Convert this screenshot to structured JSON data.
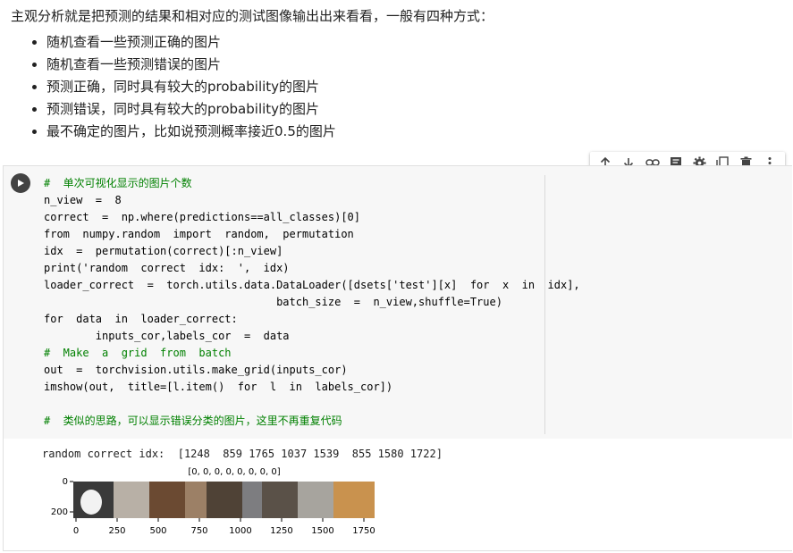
{
  "markdown": {
    "intro": "主观分析就是把预测的结果和相对应的测试图像输出出来看看，一般有四种方式：",
    "items": [
      "随机查看一些预测正确的图片",
      "随机查看一些预测错误的图片",
      "预测正确，同时具有较大的probability的图片",
      "预测错误，同时具有较大的probability的图片",
      "最不确定的图片，比如说预测概率接近0.5的图片"
    ]
  },
  "toolbar": {
    "icons": [
      "arrow-up-icon",
      "arrow-down-icon",
      "link-icon",
      "comment-icon",
      "gear-icon",
      "mirror-cell-icon",
      "trash-icon",
      "more-vert-icon"
    ]
  },
  "code": {
    "lines": [
      "#  单次可视化显示的图片个数",
      "n_view  =  8",
      "correct  =  np.where(predictions==all_classes)[0]",
      "from  numpy.random  import  random,  permutation",
      "idx  =  permutation(correct)[:n_view]",
      "print('random  correct  idx:  ',  idx)",
      "loader_correct  =  torch.utils.data.DataLoader([dsets['test'][x]  for  x  in  idx],",
      "                                    batch_size  =  n_view,shuffle=True)",
      "for  data  in  loader_correct:",
      "        inputs_cor,labels_cor  =  data",
      "#  Make  a  grid  from  batch",
      "out  =  torchvision.utils.make_grid(inputs_cor)",
      "imshow(out,  title=[l.item()  for  l  in  labels_cor])",
      "",
      "#  类似的思路，可以显示错误分类的图片，这里不再重复代码"
    ]
  },
  "output": {
    "text": "random correct idx:  [1248  859 1765 1037 1539  855 1580 1722]",
    "plot_title": "[0, 0, 0, 0, 0, 0, 0, 0]",
    "yticks": [
      "0",
      "200"
    ],
    "xticks": [
      "0",
      "250",
      "500",
      "750",
      "1000",
      "1250",
      "1500",
      "1750"
    ]
  }
}
